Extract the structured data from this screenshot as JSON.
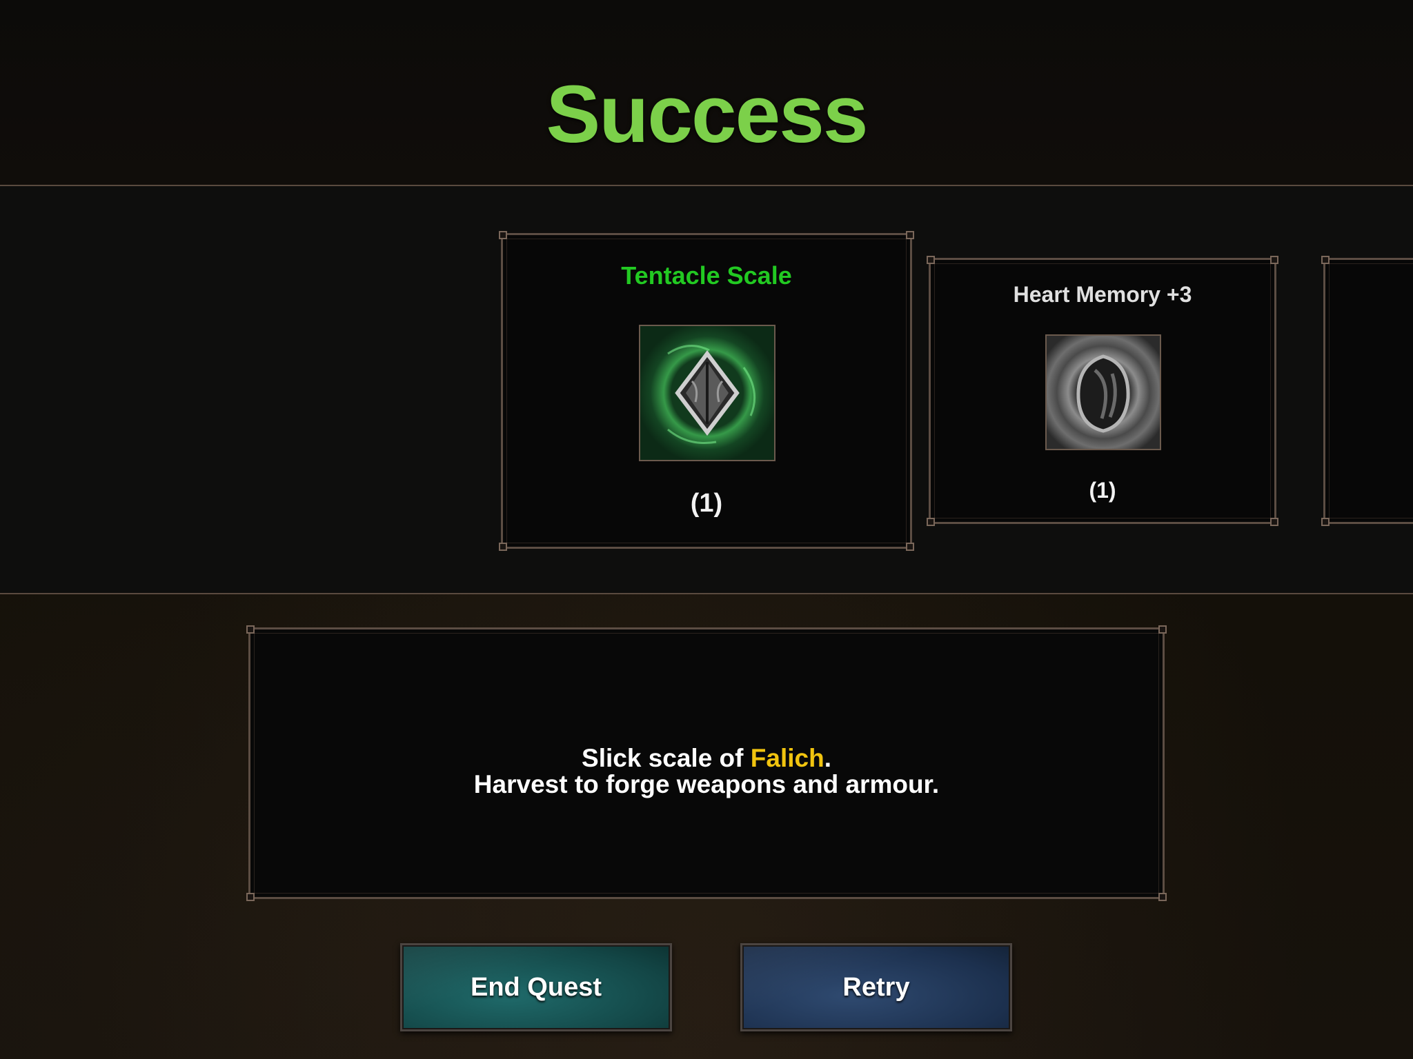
{
  "result": {
    "title": "Success"
  },
  "rewards": [
    {
      "name": "Tentacle Scale",
      "quantity": "(1)",
      "name_color": "#22c922",
      "icon": "tentacle-scale-icon",
      "selected": true
    },
    {
      "name": "Heart Memory +3",
      "quantity": "(1)",
      "name_color": "#e0e0e0",
      "icon": "heart-memory-icon",
      "selected": false
    }
  ],
  "description": {
    "line1_prefix": "Slick scale of ",
    "line1_highlight": "Falich",
    "line1_suffix": ".",
    "line2": "Harvest to forge weapons and armour.",
    "highlight_color": "#f1c40f"
  },
  "buttons": {
    "end_quest_label": "End Quest",
    "retry_label": "Retry"
  },
  "colors": {
    "title": "#7cd04a",
    "frame_border": "#5c4d43"
  }
}
